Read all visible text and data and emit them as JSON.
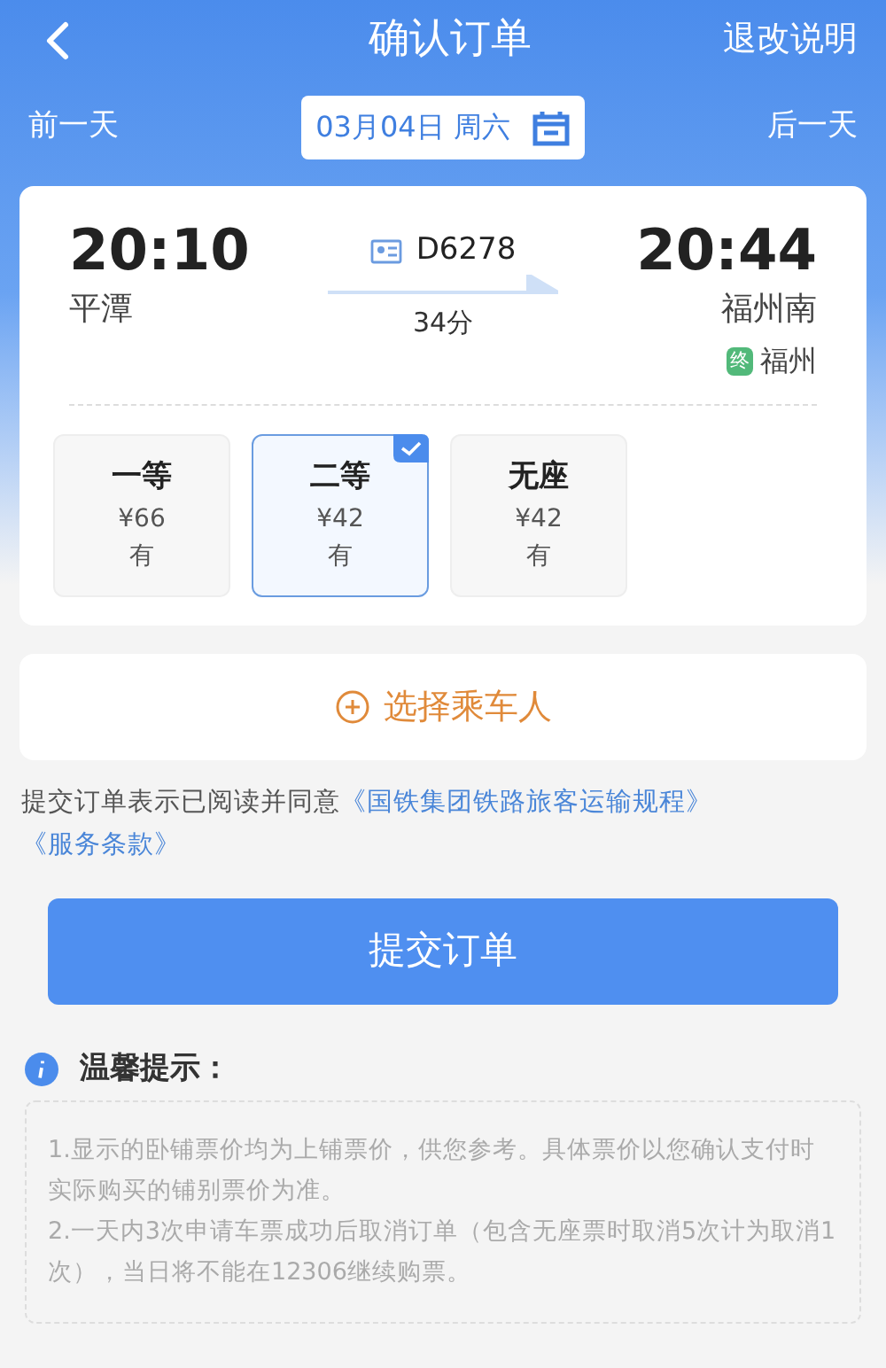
{
  "header": {
    "title": "确认订单",
    "action": "退改说明"
  },
  "date_bar": {
    "prev": "前一天",
    "date": "03月04日 周六",
    "next": "后一天"
  },
  "train": {
    "depart_time": "20:10",
    "depart_station": "平潭",
    "number": "D6278",
    "duration": "34分",
    "arrive_time": "20:44",
    "arrive_station": "福州南",
    "terminal_badge": "终",
    "terminal_station": "福州"
  },
  "seats": [
    {
      "name": "一等",
      "price": "¥66",
      "availability": "有",
      "selected": false
    },
    {
      "name": "二等",
      "price": "¥42",
      "availability": "有",
      "selected": true
    },
    {
      "name": "无座",
      "price": "¥42",
      "availability": "有",
      "selected": false
    }
  ],
  "passenger_button": "选择乘车人",
  "agreement": {
    "text": "提交订单表示已阅读并同意",
    "links": [
      "《国铁集团铁路旅客运输规程》",
      "《服务条款》"
    ]
  },
  "submit_button": "提交订单",
  "tips": {
    "title": "温馨提示：",
    "items": [
      "1.显示的卧铺票价均为上铺票价，供您参考。具体票价以您确认支付时实际购买的铺别票价为准。",
      "2.一天内3次申请车票成功后取消订单（包含无座票时取消5次计为取消1次），当日将不能在12306继续购票。"
    ]
  }
}
